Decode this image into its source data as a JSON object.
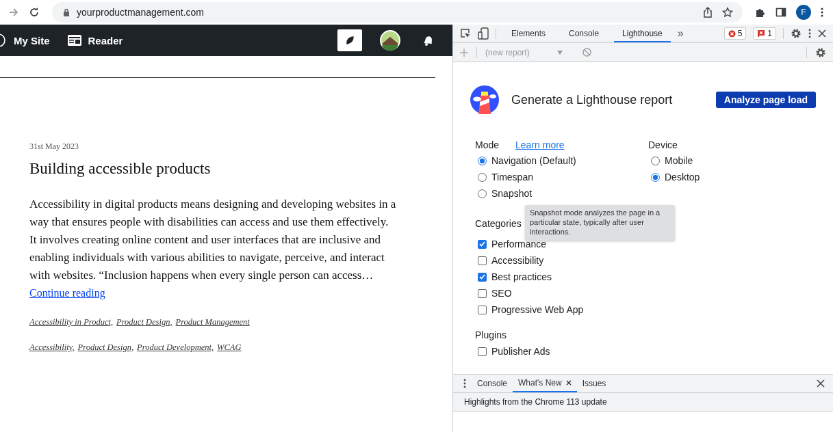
{
  "browser": {
    "url": "yourproductmanagement.com",
    "profile_letter": "F"
  },
  "site_bar": {
    "items": [
      {
        "label": "My Site",
        "kind": "wordpress"
      },
      {
        "label": "Reader",
        "kind": "reader"
      }
    ]
  },
  "page": {
    "post": {
      "date": "31st May 2023",
      "title": "Building accessible products",
      "excerpt": "Accessibility in digital products means designing and developing websites in a way that ensures people with disabilities can access and use them effectively. It involves creating online content and user interfaces that are inclusive and enabling individuals with various abilities to navigate, perceive, and interact with websites. “Inclusion happens when every single person can access…",
      "link": "Continue reading",
      "categories": [
        "Accessibility in Product,",
        "Product Design,",
        "Product Management"
      ],
      "tags": [
        "Accessibility,",
        "Product Design,",
        "Product Development,",
        "WCAG"
      ]
    }
  },
  "devtools": {
    "tabs": [
      {
        "label": "Elements",
        "selected": false
      },
      {
        "label": "Console",
        "selected": false
      },
      {
        "label": "Lighthouse",
        "selected": true
      }
    ],
    "more": "»",
    "error_count": "5",
    "issue_count": "1",
    "report_select": "(new report)",
    "lighthouse": {
      "title": "Generate a Lighthouse report",
      "analyze_button": "Analyze page load",
      "mode_label": "Mode",
      "learn_more": "Learn more",
      "modes": [
        {
          "label": "Navigation (Default)",
          "selected": true
        },
        {
          "label": "Timespan",
          "selected": false
        },
        {
          "label": "Snapshot",
          "selected": false
        }
      ],
      "device_label": "Device",
      "devices": [
        {
          "label": "Mobile",
          "selected": false
        },
        {
          "label": "Desktop",
          "selected": true
        }
      ],
      "tooltip": "Snapshot mode analyzes the page in a particular state, typically after user interactions.",
      "categories_label": "Categories",
      "categories": [
        {
          "label": "Performance",
          "checked": true
        },
        {
          "label": "Accessibility",
          "checked": false
        },
        {
          "label": "Best practices",
          "checked": true
        },
        {
          "label": "SEO",
          "checked": false
        },
        {
          "label": "Progressive Web App",
          "checked": false
        }
      ],
      "plugins_label": "Plugins",
      "plugins": [
        {
          "label": "Publisher Ads",
          "checked": false
        }
      ]
    },
    "drawer": {
      "tabs": [
        {
          "label": "Console",
          "selected": false,
          "closable": false
        },
        {
          "label": "What's New",
          "selected": true,
          "closable": true
        },
        {
          "label": "Issues",
          "selected": false,
          "closable": false
        }
      ],
      "headline": "Highlights from the Chrome 113 update"
    }
  }
}
